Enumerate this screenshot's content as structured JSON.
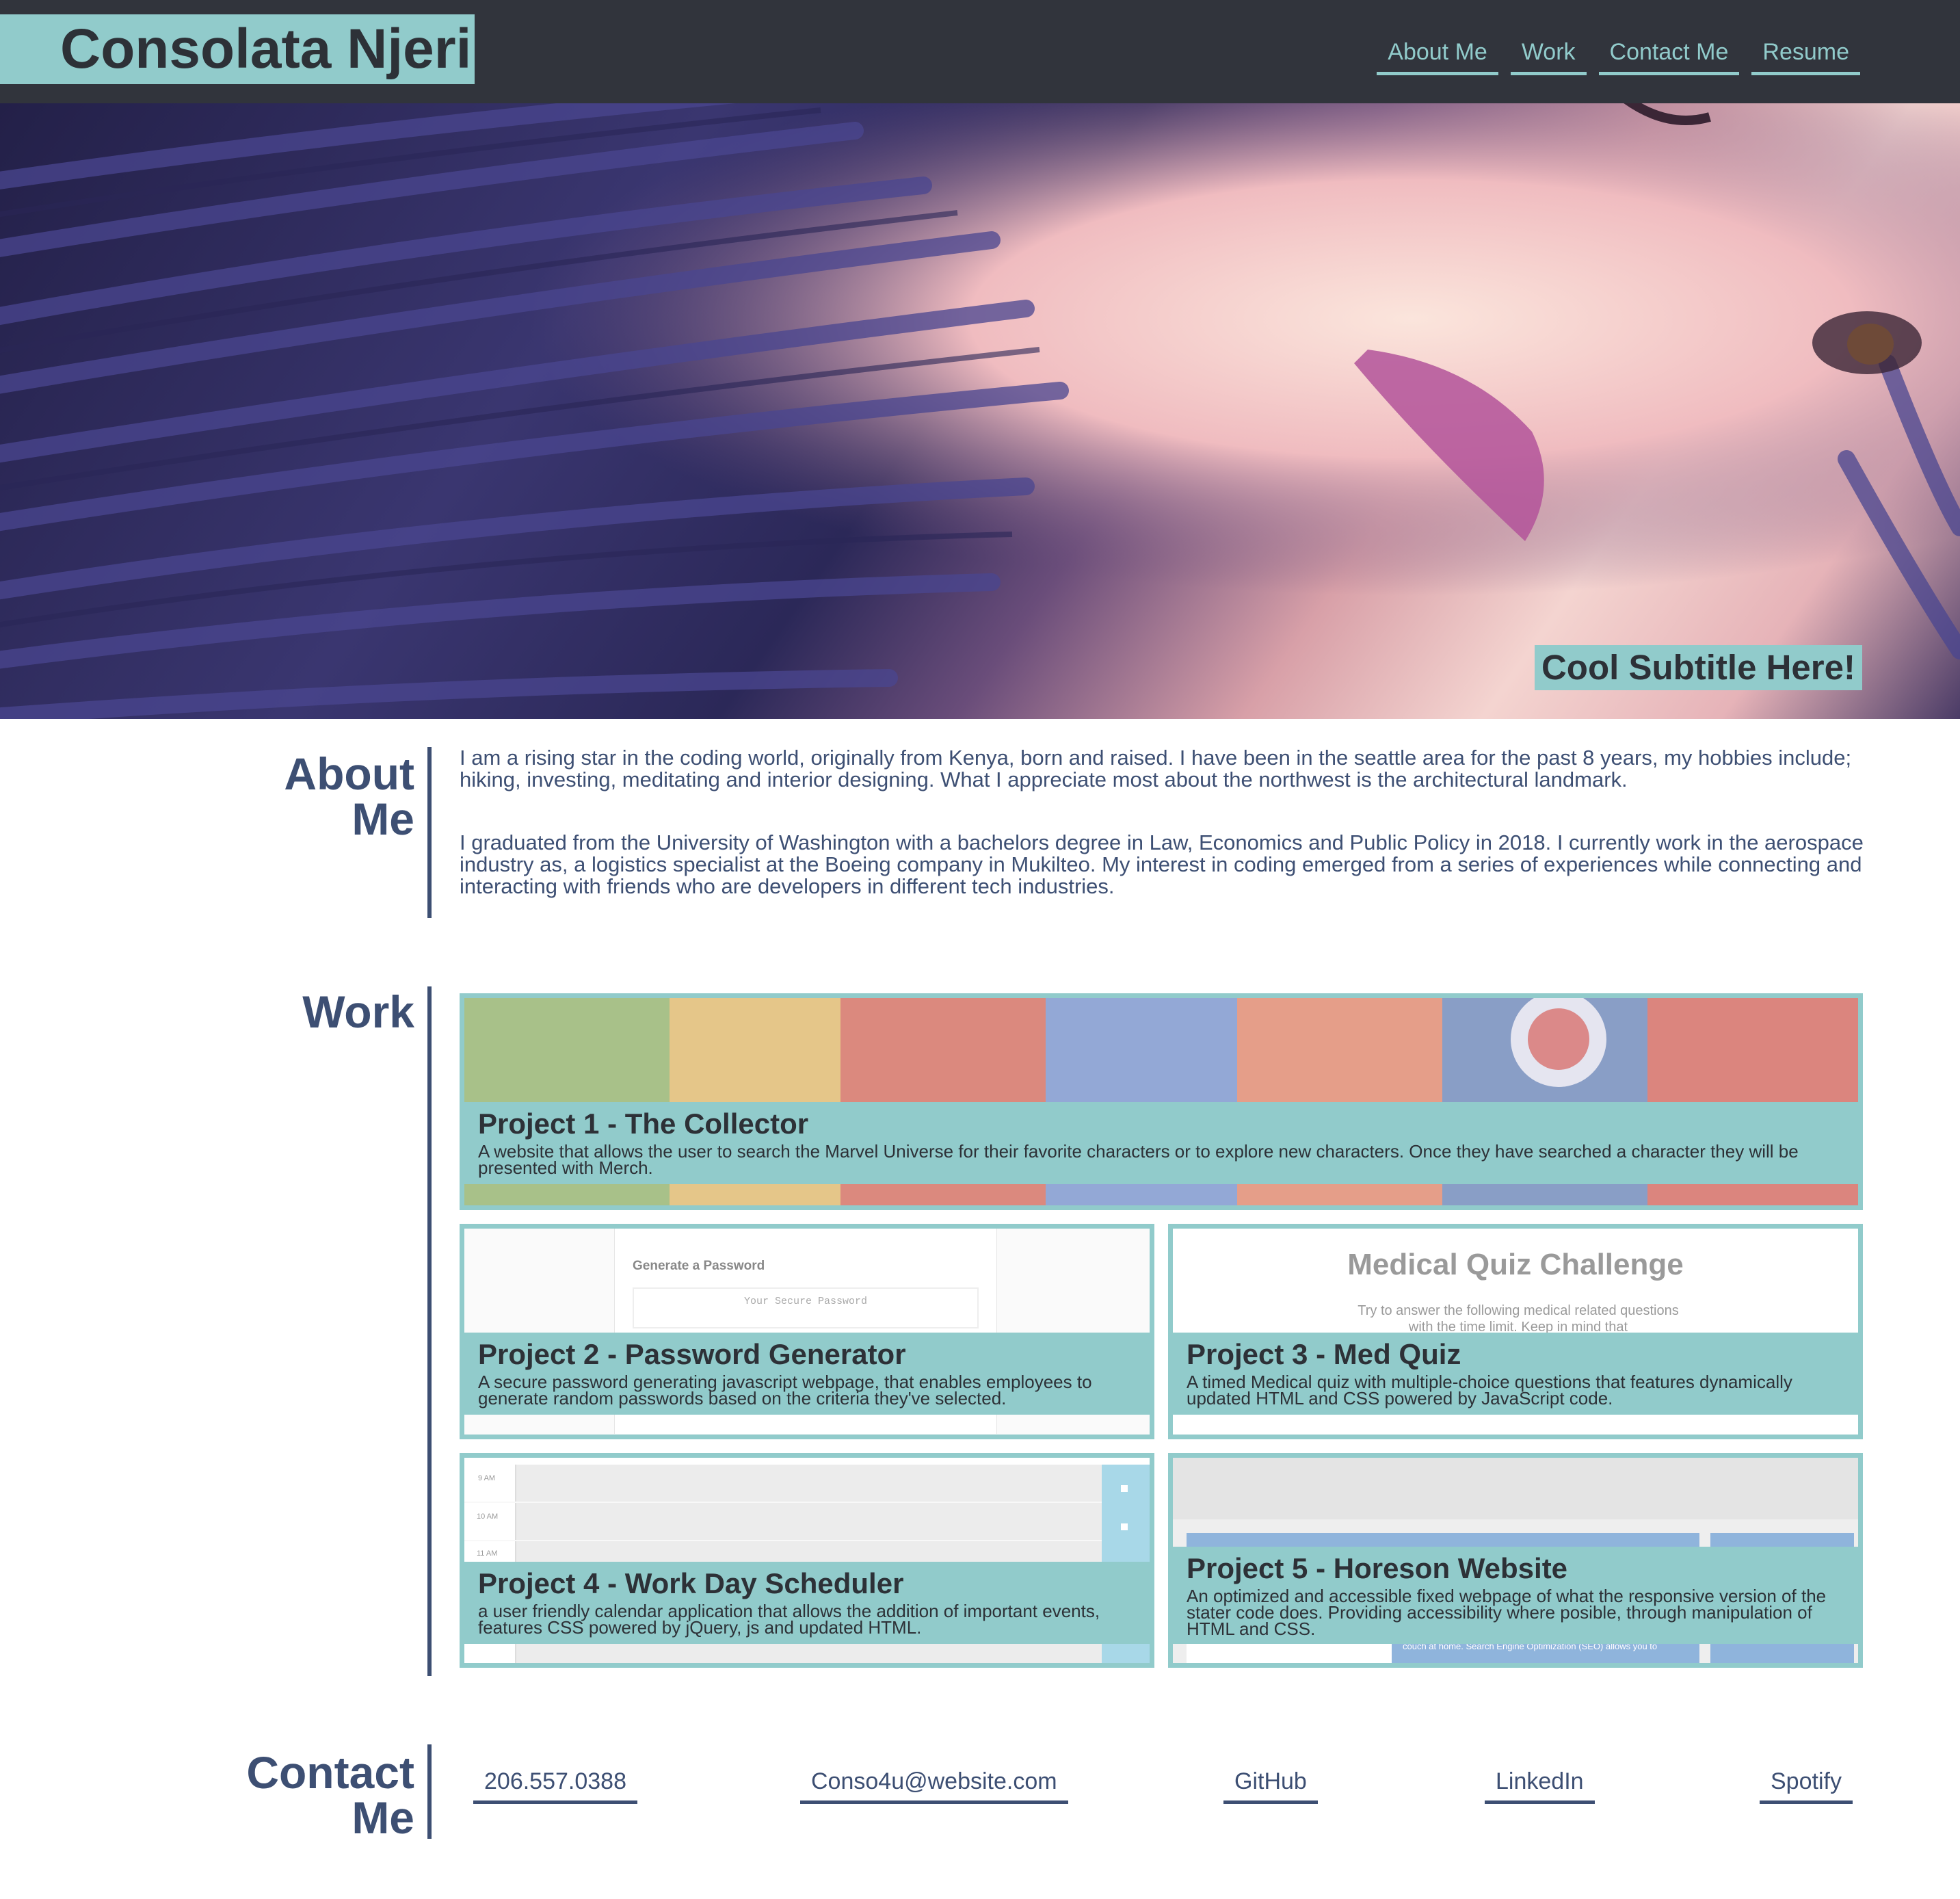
{
  "header": {
    "brand": "Consolata Njeri",
    "nav": [
      "About Me",
      "Work",
      "Contact Me",
      "Resume"
    ]
  },
  "hero": {
    "subtitle": "Cool Subtitle Here!"
  },
  "about": {
    "title_line1": "About",
    "title_line2": "Me",
    "paragraphs": [
      "I am a rising star in the coding world, originally from Kenya, born and raised. I have been in the seattle area for the past 8 years, my hobbies include; hiking, investing, meditating and interior designing. What I appreciate most about the northwest is the architectural landmark.",
      "I graduated from the University of Washington with a bachelors degree in Law, Economics and Public Policy in 2018. I currently work in the aerospace industry as, a logistics specialist at the Boeing company in Mukilteo. My interest in coding emerged from a series of experiences while connecting and interacting with friends who are developers in different tech industries."
    ]
  },
  "work": {
    "title": "Work",
    "projects": [
      {
        "title": "Project 1 - The Collector",
        "description": "A website that allows the user to search the Marvel Universe for their favorite characters or to explore new characters. Once they have searched a character they will be presented with Merch."
      },
      {
        "title": "Project 2 - Password Generator",
        "description": "A secure password generating javascript webpage, that enables employees to generate random passwords based on the criteria they've selected.",
        "preview_heading": "Generate a Password",
        "preview_placeholder": "Your Secure Password"
      },
      {
        "title": "Project 3 - Med Quiz",
        "description": "A timed Medical quiz with multiple-choice questions that features dynamically updated HTML and CSS powered by JavaScript code.",
        "preview_heading": "Medical Quiz Challenge",
        "preview_text": "Try to answer the following medical related questions with the time limit. Keep in mind that"
      },
      {
        "title": "Project 4 - Work Day Scheduler",
        "description": "a user friendly calendar application that allows the addition of important events, features CSS powered by jQuery, js and updated HTML.",
        "preview_hours": [
          "9 AM",
          "10 AM",
          "11 AM"
        ]
      },
      {
        "title": "Project 5 - Horeson Website",
        "description": "An optimized and accessible fixed webpage of what the responsive version of the stater code does. Providing accessibility where posible, through manipulation of HTML and CSS.",
        "preview_text": "couch at home. Search Engine Optimization (SEO) allows you to"
      }
    ]
  },
  "contact": {
    "title_line1": "Contact",
    "title_line2": "Me",
    "links": [
      "206.557.0388",
      "Conso4u@website.com",
      "GitHub",
      "LinkedIn",
      "Spotify"
    ]
  },
  "colors": {
    "header_bg": "#31343c",
    "accent": "#91cbcb",
    "text": "#3d4f73",
    "dark_text": "#2d3137"
  }
}
